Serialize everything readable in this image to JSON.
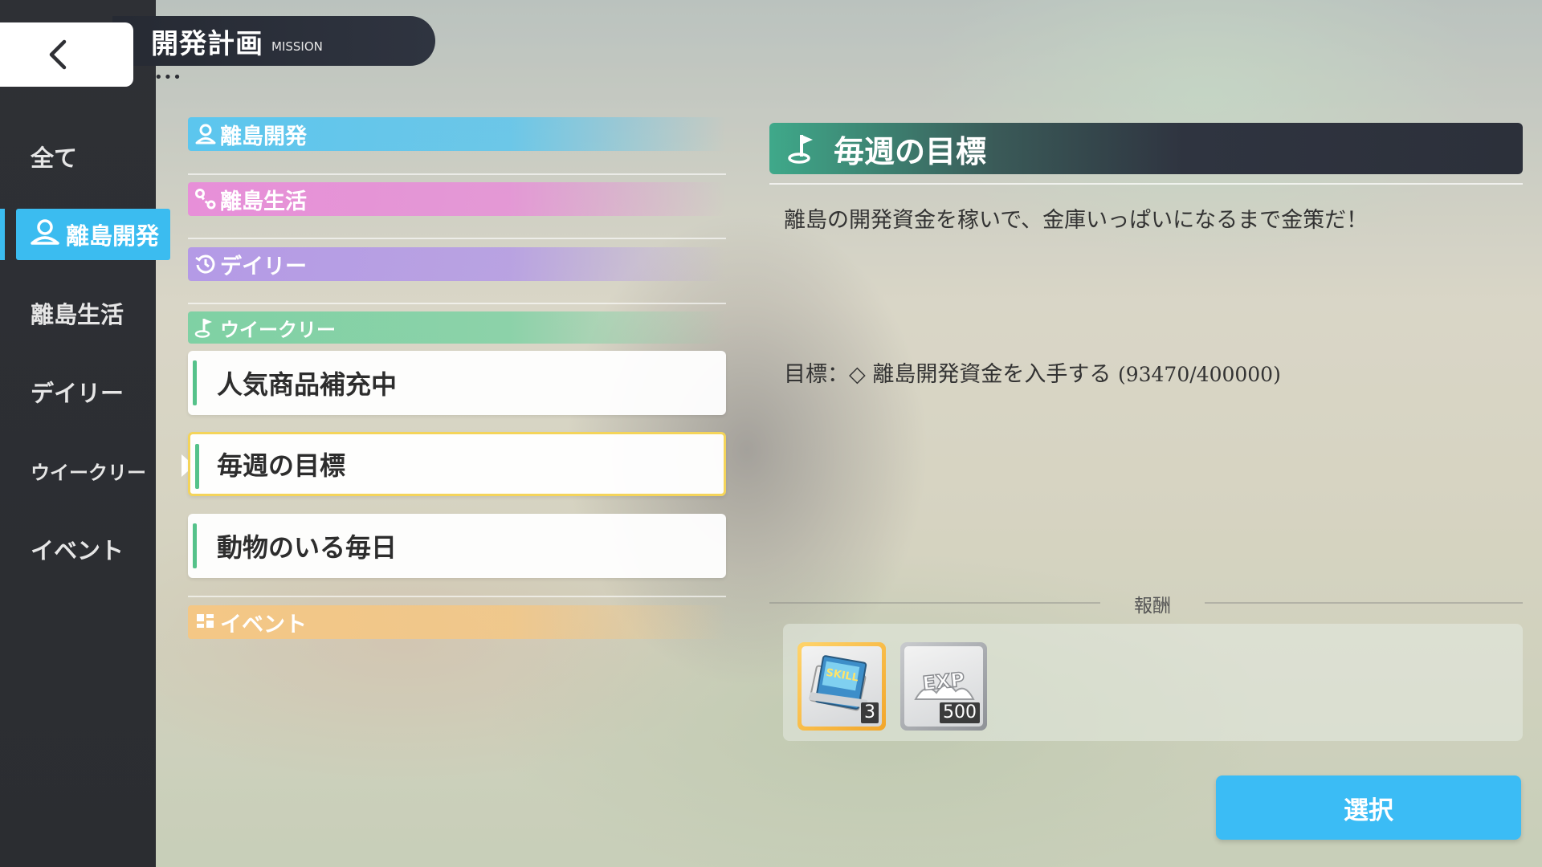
{
  "header": {
    "title": "開発計画",
    "subtitle": "MISSION",
    "dots": "•••"
  },
  "sidebar": {
    "items": [
      {
        "label": "全て",
        "active": false
      },
      {
        "label": "離島開発",
        "active": true
      },
      {
        "label": "離島生活",
        "active": false
      },
      {
        "label": "デイリー",
        "active": false
      },
      {
        "label": "ウイークリー",
        "active": false
      },
      {
        "label": "イベント",
        "active": false
      }
    ]
  },
  "categories": [
    {
      "label": "離島開発",
      "icon": "map-pin-icon",
      "color": "#5cc6ee"
    },
    {
      "label": "離島生活",
      "icon": "route-icon",
      "color": "#e78fd8"
    },
    {
      "label": "デイリー",
      "icon": "clock-icon",
      "color": "#b49ae6"
    },
    {
      "label": "ウイークリー",
      "icon": "flag-icon",
      "color": "#7fd1a4"
    },
    {
      "label": "イベント",
      "icon": "grid-icon",
      "color": "#f4c785"
    }
  ],
  "missions": [
    {
      "label": "人気商品補充中",
      "selected": false
    },
    {
      "label": "毎週の目標",
      "selected": true
    },
    {
      "label": "動物のいる毎日",
      "selected": false
    }
  ],
  "detail": {
    "title": "毎週の目標",
    "icon": "flag-icon",
    "description": "離島の開発資金を稼いで、金庫いっぱいになるまで金策だ！",
    "goal_prefix": "目標：◇ 離島開発資金を入手する",
    "goal_progress": "(93470/400000)",
    "goal_current": 93470,
    "goal_total": 400000
  },
  "rewards": {
    "label": "報酬",
    "items": [
      {
        "icon": "skill-book-icon",
        "count": "3",
        "rarity": "gold"
      },
      {
        "icon": "exp-icon",
        "count": "500",
        "rarity": "silver"
      }
    ]
  },
  "select_button": "選択",
  "colors": {
    "accent": "#3bbcf0",
    "sidebar_bg": "#2d2f34",
    "selected_border": "#f4d45a",
    "card_marker": "#55c28a"
  }
}
